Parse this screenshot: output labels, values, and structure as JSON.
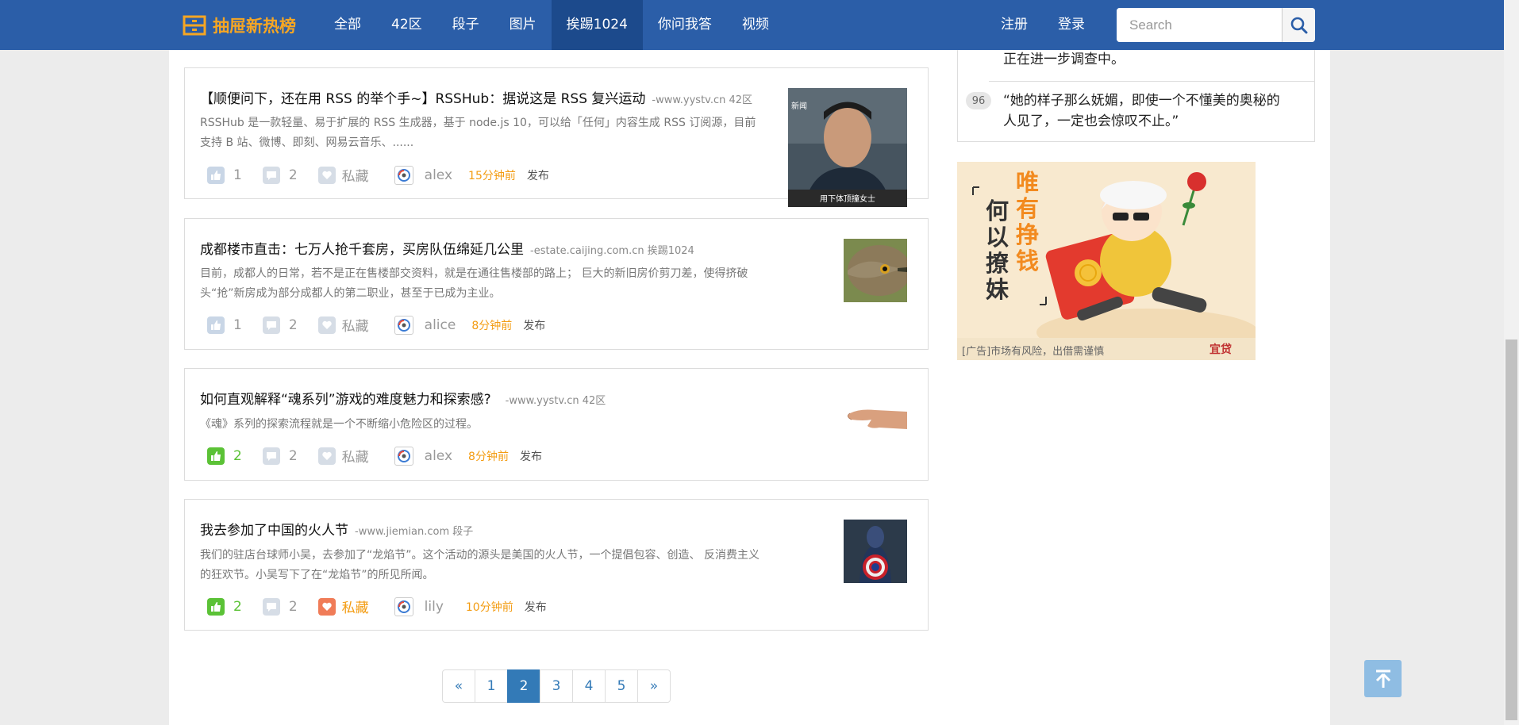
{
  "brand": {
    "name": "抽屉新热榜",
    "color": "#f6a623"
  },
  "nav": {
    "items": [
      "全部",
      "42区",
      "段子",
      "图片",
      "挨踢1024",
      "你问我答",
      "视频"
    ],
    "active_index": 4
  },
  "auth": {
    "register": "注册",
    "login": "登录"
  },
  "search": {
    "placeholder": "Search"
  },
  "sidebar": {
    "item_prev_text": "正在进一步调查中。",
    "item": {
      "badge": "96",
      "text_line1": "“她的样子那么妩媚，即使一个不懂美的奥秘的",
      "text_line2": "人见了，一定也会惊叹不止。”"
    }
  },
  "ad": {
    "left_text": "何以撩妹",
    "right_text": "唯有挣钱",
    "disclaimer": "[广告]市场有风险，出借需谨慎",
    "brand_text": "宜贷"
  },
  "posts": [
    {
      "title": "【顺便问下，还在用 RSS 的举个手~】RSSHub：据说这是 RSS 复兴运动",
      "source": "-www.yystv.cn 42区",
      "desc_line1": "RSSHub 是一款轻量、易于扩展的 RSS 生成器，基于 node.js 10，可以给「任何」内容生成 RSS 订阅源，目前",
      "desc_line2": "支持 B 站、微博、即刻、网易云音乐、......",
      "likes": "1",
      "comments": "2",
      "collect": "私藏",
      "author": "alex",
      "time": "15分钟前",
      "publish": "发布",
      "liked": false,
      "collected": false,
      "thumb_caption": "用下体顶撞女士",
      "thumb_tag": "新闻"
    },
    {
      "title": "成都楼市直击：七万人抢千套房，买房队伍绵延几公里",
      "source": "-estate.caijing.com.cn 挨踢1024",
      "desc_line1": "目前，成都人的日常，若不是正在售楼部交资料，就是在通往售楼部的路上； 巨大的新旧房价剪刀差，使得挤破",
      "desc_line2": "头“抢”新房成为部分成都人的第二职业，甚至于已成为主业。",
      "likes": "1",
      "comments": "2",
      "collect": "私藏",
      "author": "alice",
      "time": "8分钟前",
      "publish": "发布",
      "liked": false,
      "collected": false
    },
    {
      "title": "如何直观解释“魂系列”游戏的难度魅力和探索感?",
      "source": "-www.yystv.cn 42区",
      "desc_line1": "《魂》系列的探索流程就是一个不断缩小危险区的过程。",
      "likes": "2",
      "comments": "2",
      "collect": "私藏",
      "author": "alex",
      "time": "8分钟前",
      "publish": "发布",
      "liked": true,
      "collected": false
    },
    {
      "title": "我去参加了中国的火人节",
      "source": "-www.jiemian.com 段子",
      "desc_line1": "我们的驻店台球师小吴，去参加了“龙焰节”。这个活动的源头是美国的火人节，一个提倡包容、创造、 反消费主义",
      "desc_line2": "的狂欢节。小吴写下了在“龙焰节”的所见所闻。",
      "likes": "2",
      "comments": "2",
      "collect": "私藏",
      "author": "lily",
      "time": "10分钟前",
      "publish": "发布",
      "liked": true,
      "collected": true
    }
  ],
  "pagination": {
    "prev": "«",
    "pages": [
      "1",
      "2",
      "3",
      "4",
      "5"
    ],
    "active": "2",
    "next": "»"
  },
  "colors": {
    "nav_bg": "#2b5ea8",
    "nav_active": "#1c4a8c",
    "like_active": "#5bc236",
    "collect_active": "#f07c58",
    "time": "#f39c12",
    "link": "#337ab7"
  }
}
